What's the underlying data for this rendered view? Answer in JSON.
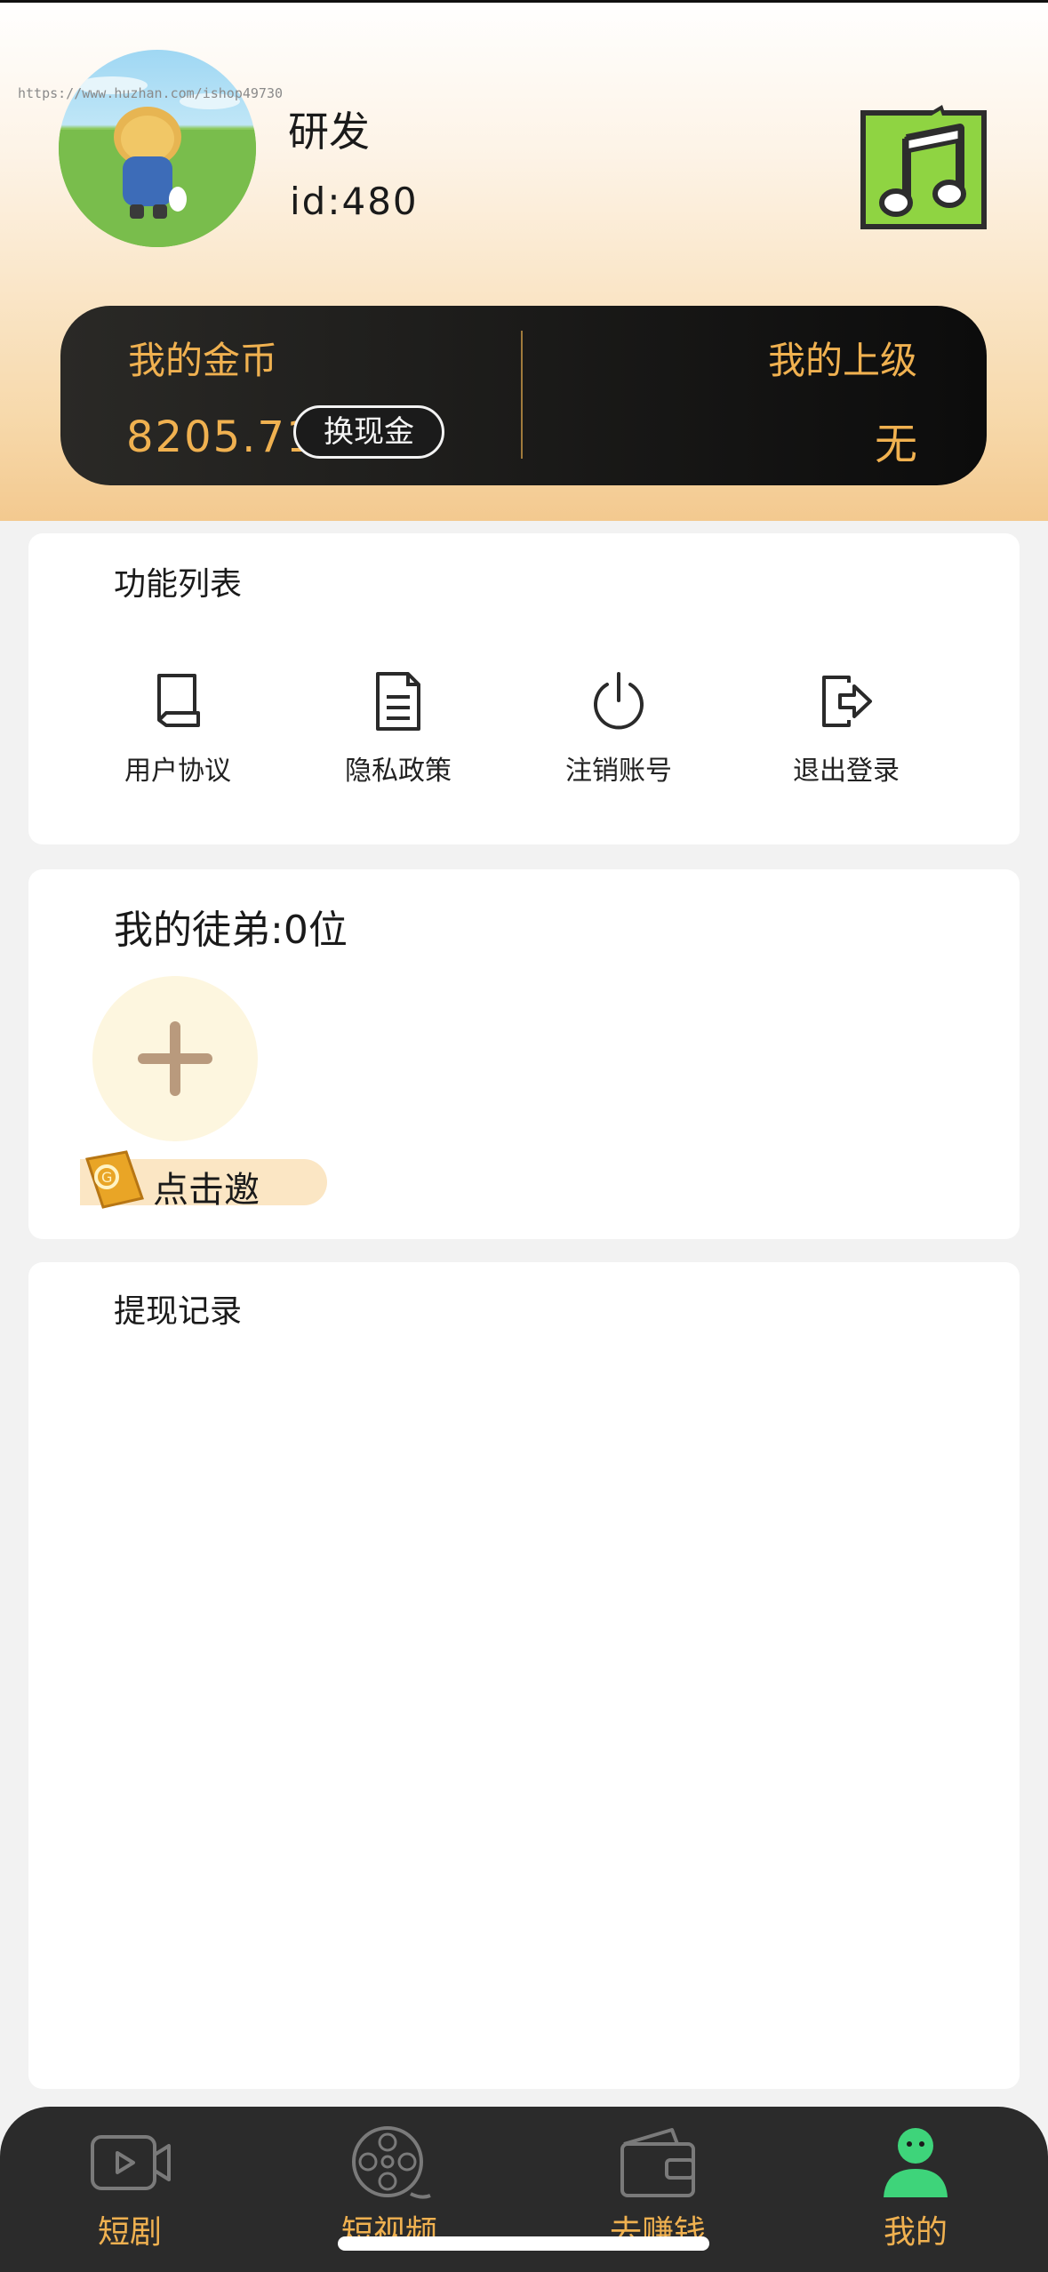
{
  "watermark": "https://www.huzhan.com/ishop49730",
  "profile": {
    "nickname": "研发",
    "user_id": "id:480"
  },
  "music_button": {
    "icon": "music-note-icon"
  },
  "coins": {
    "label": "我的金币",
    "value": "8205.71",
    "exchange_label": "换现金",
    "superior_label": "我的上级",
    "superior_value": "无"
  },
  "functions": {
    "title": "功能列表",
    "items": [
      {
        "label": "用户协议",
        "icon": "agreement-icon"
      },
      {
        "label": "隐私政策",
        "icon": "document-icon"
      },
      {
        "label": "注销账号",
        "icon": "power-icon"
      },
      {
        "label": "退出登录",
        "icon": "logout-icon"
      }
    ]
  },
  "disciples": {
    "title": "我的徒弟:0位",
    "invite_label": "点击邀"
  },
  "withdraw": {
    "title": "提现记录"
  },
  "tabbar": {
    "items": [
      {
        "label": "短剧",
        "icon": "video-play-icon"
      },
      {
        "label": "短视频",
        "icon": "film-reel-icon"
      },
      {
        "label": "去赚钱",
        "icon": "wallet-icon"
      },
      {
        "label": "我的",
        "icon": "user-icon"
      }
    ],
    "active_color": "#3ed47a",
    "label_color": "#f0b150"
  },
  "colors": {
    "accent_gold": "#f0b150",
    "card_dark": "#111111",
    "tabbar_bg": "#2b2b2b"
  }
}
